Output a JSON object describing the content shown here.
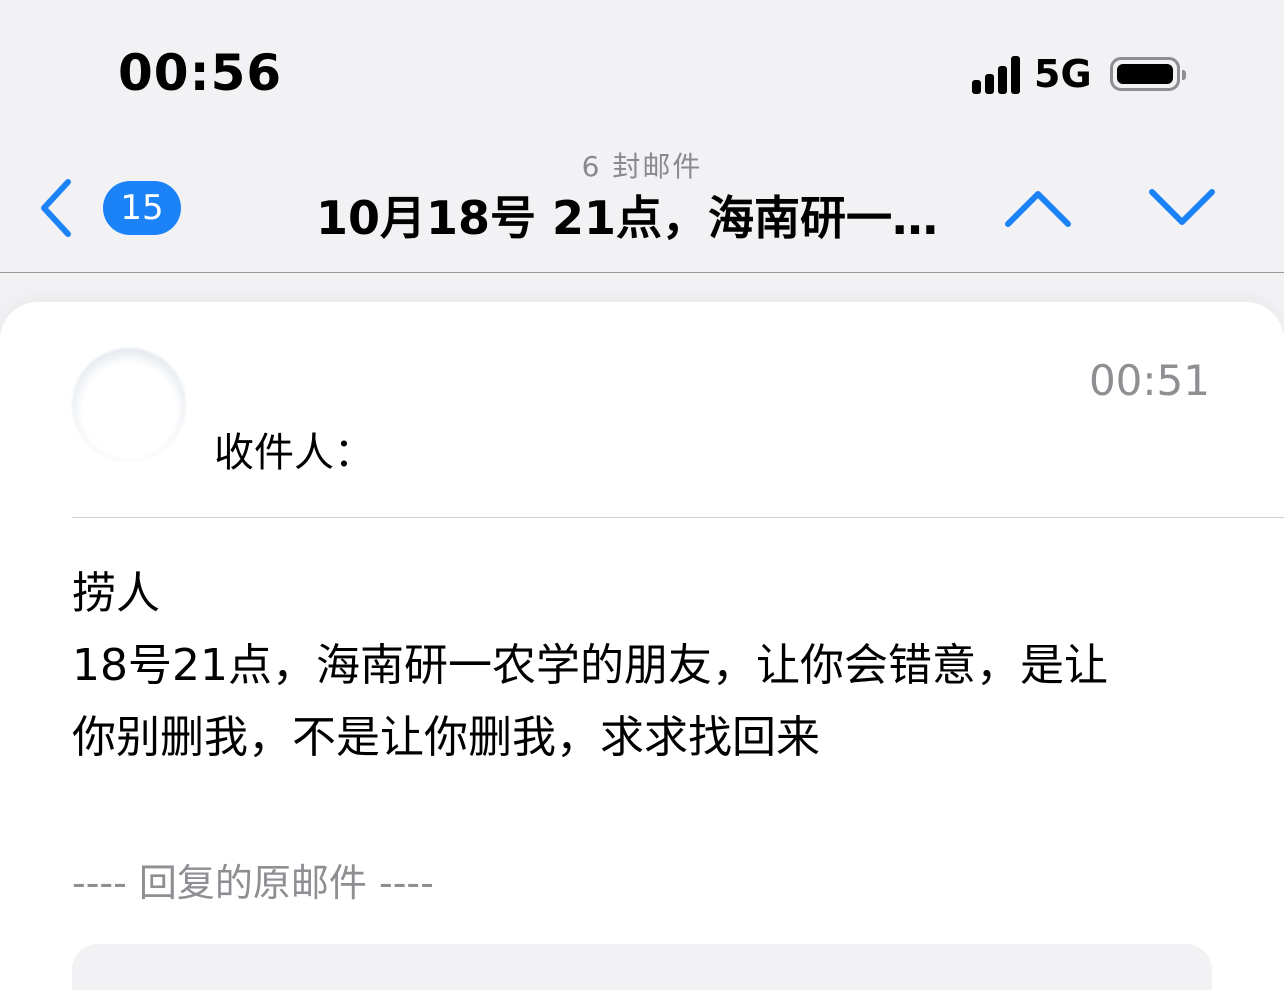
{
  "status_bar": {
    "time": "00:56",
    "network": "5G",
    "icons": [
      "signal-icon",
      "battery-icon"
    ]
  },
  "nav": {
    "back_icon": "chevron-left-icon",
    "unread_badge": "15",
    "message_count": "6 封邮件",
    "title": "10月18号 21点，海南研一…",
    "prev_icon": "chevron-up-icon",
    "next_icon": "chevron-down-icon",
    "accent_color": "#1b82f7"
  },
  "email": {
    "time": "00:51",
    "recipient_label": "收件人：",
    "body_lines": [
      "捞人",
      "18号21点，海南研一农学的朋友，让你会错意，是让",
      "你别删我，不是让你删我，求求找回来"
    ],
    "quoted_separator": "---- 回复的原邮件 ----"
  }
}
